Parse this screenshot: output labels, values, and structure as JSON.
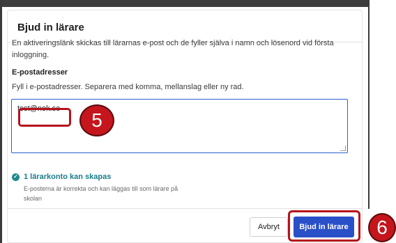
{
  "dialog": {
    "title": "Bjud in lärare",
    "info": "En aktiveringslänk skickas till lärarnas e-post och de fyller själva i namn och lösenord vid första inloggning.",
    "email_label": "E-postadresser",
    "email_help": "Fyll i e-postadresser. Separera med komma, mellanslag eller ny rad.",
    "email_value": "test@nok.se",
    "status_title": "1 lärarkonto kan skapas",
    "status_desc": "E-posterna är korrekta och kan läggas till som lärare på skolan",
    "cancel_label": "Avbryt",
    "invite_label": "Bjud in lärare"
  },
  "annotations": {
    "step_5": "5",
    "step_6": "6"
  },
  "colors": {
    "primary_button": "#2a50c8",
    "success": "#1a7d8a",
    "highlight": "#b5121b"
  },
  "icons": {
    "status": "check-circle-icon"
  }
}
